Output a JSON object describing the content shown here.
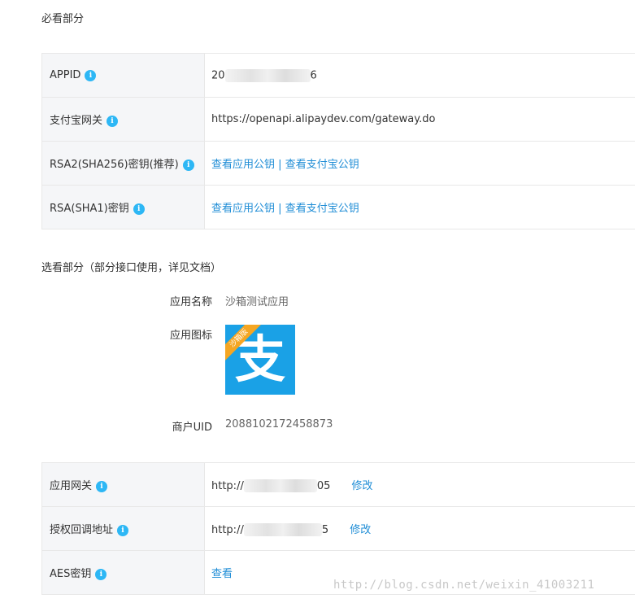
{
  "required_section": {
    "title": "必看部分",
    "rows": [
      {
        "key": "APPID",
        "value_prefix": "20",
        "value_suffix": "6"
      },
      {
        "key": "支付宝网关",
        "value": "https://openapi.alipaydev.com/gateway.do"
      },
      {
        "key": "RSA2(SHA256)密钥(推荐)",
        "link1": "查看应用公钥",
        "sep": "|",
        "link2": "查看支付宝公钥"
      },
      {
        "key": "RSA(SHA1)密钥",
        "link1": "查看应用公钥",
        "sep": "|",
        "link2": "查看支付宝公钥"
      }
    ]
  },
  "optional_section": {
    "title": "选看部分（部分接口使用，详见文档）",
    "app_name_label": "应用名称",
    "app_name_value": "沙箱测试应用",
    "app_icon_label": "应用图标",
    "app_icon_badge": "沙箱版",
    "app_icon_glyph": "支",
    "merchant_uid_label": "商户UID",
    "merchant_uid_value": "2088102172458873"
  },
  "gateway_section": {
    "rows": [
      {
        "key": "应用网关",
        "value_prefix": "http://",
        "value_suffix": "05",
        "action": "修改"
      },
      {
        "key": "授权回调地址",
        "value_prefix": "http://",
        "value_suffix": "5",
        "action": "修改"
      },
      {
        "key": "AES密钥",
        "link": "查看"
      }
    ]
  },
  "info_icon_glyph": "i",
  "watermark": "http://blog.csdn.net/weixin_41003211",
  "colors": {
    "link": "#1f8dd6",
    "info_icon": "#2db7f5",
    "key_bg": "#f5f6f8",
    "icon_bg": "#1aa1e6",
    "badge": "#f5a623"
  }
}
